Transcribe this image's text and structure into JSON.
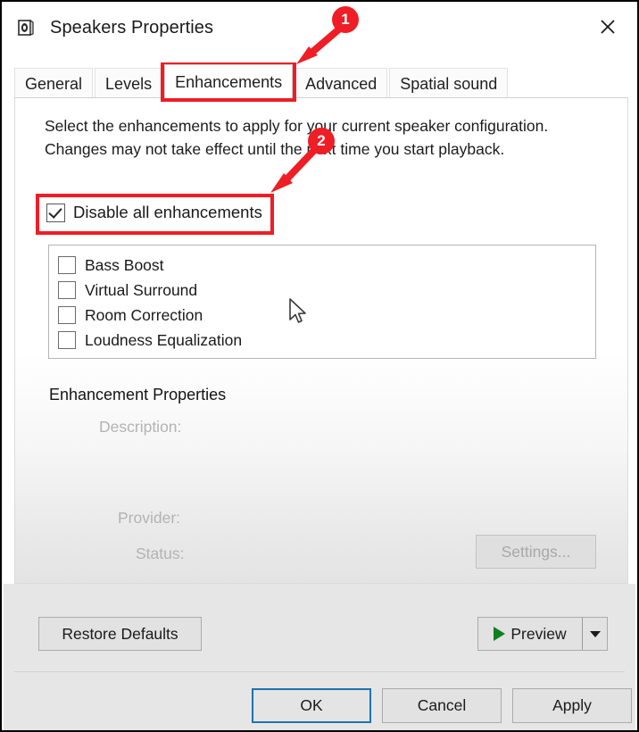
{
  "window": {
    "title": "Speakers Properties",
    "icon": "speaker-icon",
    "close_label": "Close"
  },
  "tabs": [
    {
      "label": "General",
      "selected": false
    },
    {
      "label": "Levels",
      "selected": false
    },
    {
      "label": "Enhancements",
      "selected": true
    },
    {
      "label": "Advanced",
      "selected": false
    },
    {
      "label": "Spatial sound",
      "selected": false
    }
  ],
  "content": {
    "intro": "Select the enhancements to apply for your current speaker configuration. Changes may not take effect until the next time you start playback.",
    "disable_all": {
      "label": "Disable all enhancements",
      "checked": true
    },
    "enhancements": [
      {
        "label": "Bass Boost",
        "checked": false
      },
      {
        "label": "Virtual Surround",
        "checked": false
      },
      {
        "label": "Room Correction",
        "checked": false
      },
      {
        "label": "Loudness Equalization",
        "checked": false
      }
    ],
    "properties": {
      "heading": "Enhancement Properties",
      "description_label": "Description:",
      "description_value": "",
      "provider_label": "Provider:",
      "provider_value": "",
      "status_label": "Status:",
      "status_value": "",
      "settings_label": "Settings..."
    }
  },
  "actions": {
    "restore_defaults": "Restore Defaults",
    "preview": "Preview",
    "preview_dropdown": "chevron-down-icon",
    "ok": "OK",
    "cancel": "Cancel",
    "apply": "Apply"
  },
  "annotations": [
    {
      "badge": "1",
      "target": "Enhancements tab"
    },
    {
      "badge": "2",
      "target": "Disable all enhancements checkbox"
    }
  ],
  "colors": {
    "annotation_red": "#ef1d25",
    "focus_blue": "#1d73ad",
    "play_green": "#0f8020"
  }
}
